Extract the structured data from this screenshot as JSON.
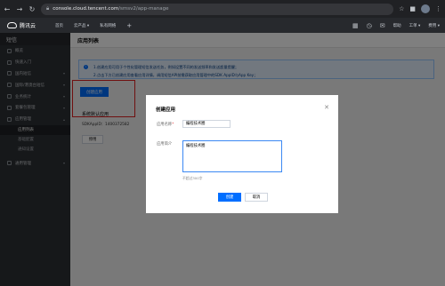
{
  "browser": {
    "url_host": "console.cloud.tencent.com",
    "url_path": "/smsv2/app-manage"
  },
  "topnav": {
    "logo_text": "腾讯云",
    "items": [
      "首页",
      "云产品 ▾",
      "私有网络"
    ],
    "right_items": [
      "帮助",
      "工单 ▾",
      "费用 ▾"
    ]
  },
  "sidebar": {
    "title": "短信",
    "items": [
      {
        "label": "概览"
      },
      {
        "label": "快速入门"
      },
      {
        "label": "国内短信",
        "chev": "▾"
      },
      {
        "label": "国际/港澳台短信",
        "chev": "▾"
      },
      {
        "label": "业务统计",
        "chev": "▾"
      },
      {
        "label": "套餐包管理",
        "chev": "▾"
      },
      {
        "label": "应用管理",
        "chev": "▴"
      }
    ],
    "sub_items": [
      {
        "label": "应用列表",
        "active": true
      },
      {
        "label": "基础配置",
        "active": false
      },
      {
        "label": "通知设置",
        "active": false
      }
    ],
    "bottom_item": {
      "label": "通用管理",
      "chev": "▾"
    }
  },
  "main": {
    "page_title": "应用列表",
    "info_line1": "1.创建应用可用于个性化管理短信发送任务，例如设置不同的发送频率和发送超量提醒；",
    "info_line2": "2.点击下方已创建应用查看应用详情，调用短信API前需获取应用管理中的SDK AppID与App Key；",
    "create_button": "创建应用",
    "app_name": "系统默认应用",
    "app_id_label": "SDKAppID：",
    "app_id": "1400372582",
    "stop_button": "停用"
  },
  "modal": {
    "title": "创建应用",
    "name_label": "应用名称",
    "name_required": "*",
    "name_value": "编程技术圈",
    "desc_label": "应用简介",
    "desc_value": "编程技术圈",
    "hint": "不超过300字",
    "ok_button": "创建",
    "cancel_button": "取消"
  }
}
